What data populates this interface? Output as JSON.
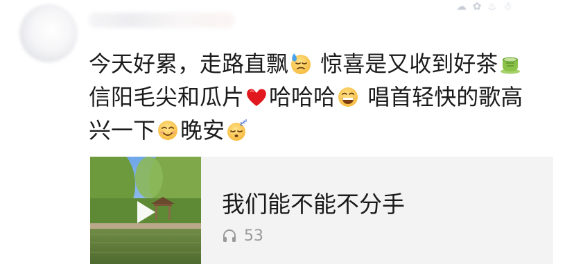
{
  "post": {
    "lines": [
      {
        "before": "今天好累，走路直飘",
        "emoji1": "sweat-smile-emoji",
        "after": " 惊喜是又收到好茶",
        "emoji2": "tea-emoji"
      },
      {
        "before": "信阳毛尖和瓜片",
        "emoji1": "red-heart-emoji",
        "middle": "哈哈哈",
        "emoji2": "grin-emoji",
        "after": " 唱首轻快的歌高"
      },
      {
        "before": "兴一下",
        "emoji1": "smile-emoji",
        "middle": "晚安",
        "emoji2": "sleeping-emoji"
      }
    ]
  },
  "music": {
    "title": "我们能不能不分手",
    "play_count": "53",
    "cover_icon": "play-icon",
    "count_icon": "headphone-icon"
  },
  "colors": {
    "background": "#ffffff",
    "card": "#f3f3f3",
    "muted": "#9a9a9a",
    "text": "#1b1b1b"
  }
}
